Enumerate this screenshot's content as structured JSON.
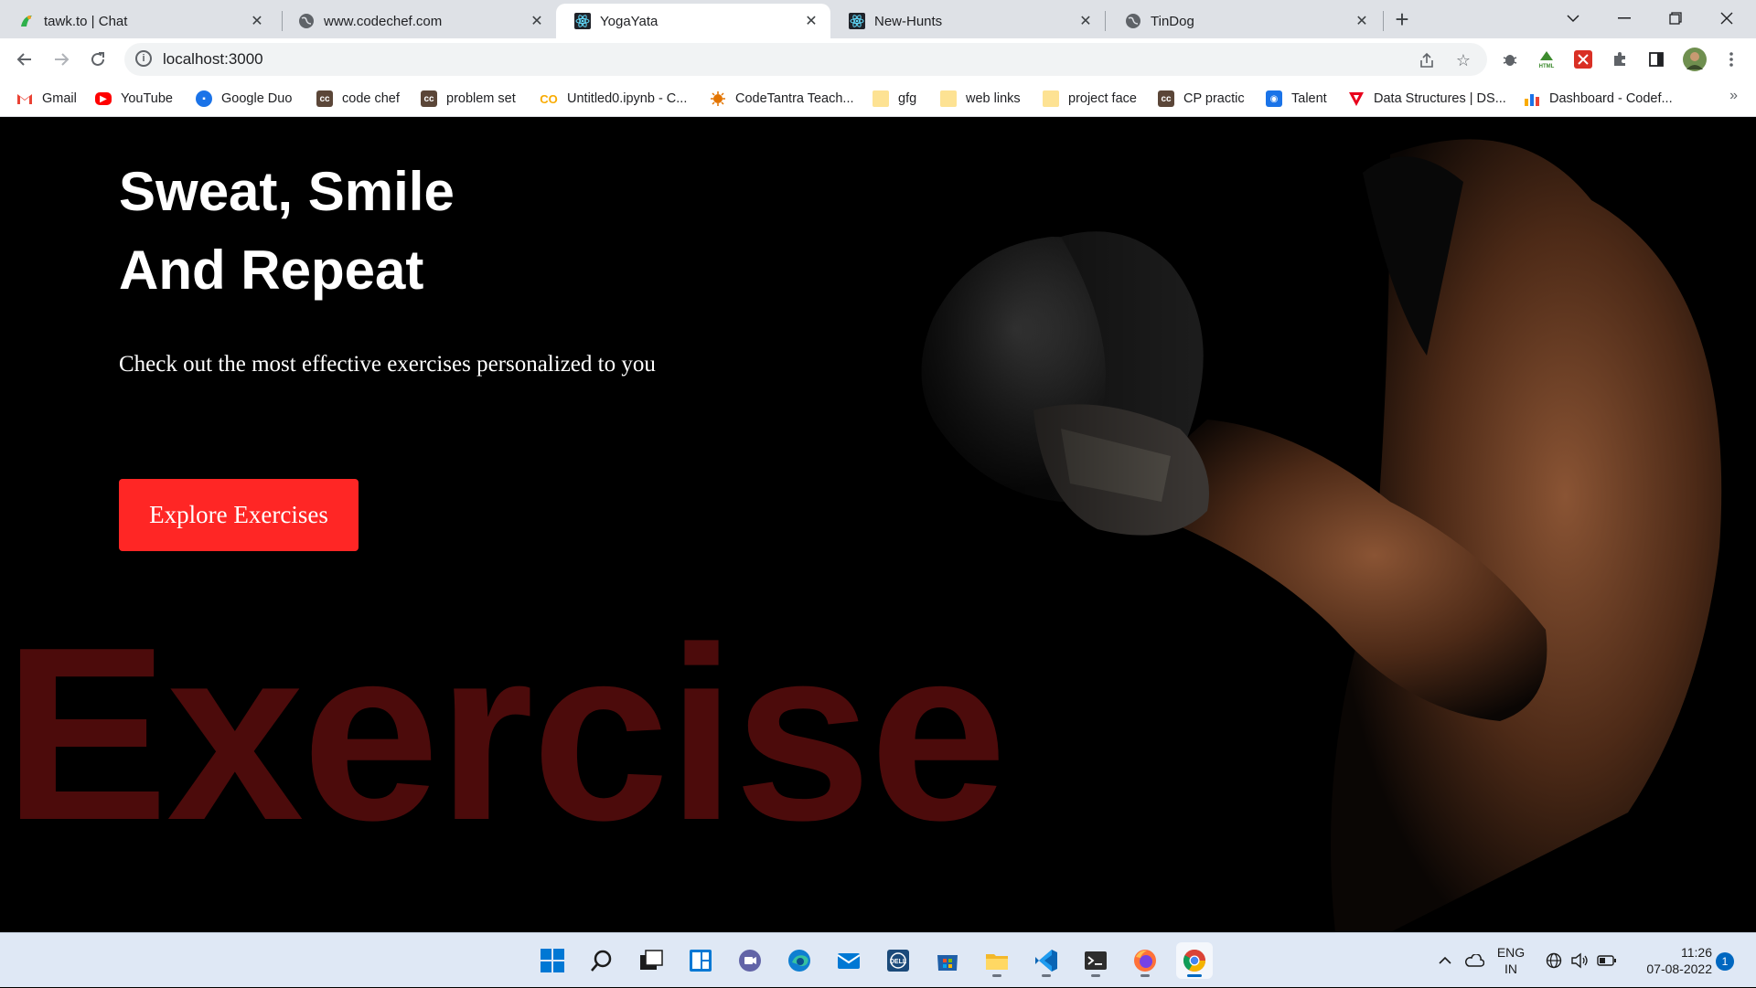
{
  "browser": {
    "tabs": [
      {
        "title": "tawk.to | Chat",
        "icon": "tawk-icon",
        "active": false
      },
      {
        "title": "www.codechef.com",
        "icon": "globe-icon",
        "active": false
      },
      {
        "title": "YogaYata",
        "icon": "react-icon",
        "active": true
      },
      {
        "title": "New-Hunts",
        "icon": "react-icon",
        "active": false
      },
      {
        "title": "TinDog",
        "icon": "globe-icon",
        "active": false
      }
    ],
    "url": "localhost:3000",
    "bookmarks": [
      {
        "label": "Gmail",
        "icon": "gmail-icon"
      },
      {
        "label": "YouTube",
        "icon": "youtube-icon"
      },
      {
        "label": "Google Duo",
        "icon": "duo-icon"
      },
      {
        "label": "code chef",
        "icon": "codechef-icon"
      },
      {
        "label": "problem set",
        "icon": "codechef-icon"
      },
      {
        "label": "Untitled0.ipynb - C...",
        "icon": "colab-icon"
      },
      {
        "label": "CodeTantra Teach...",
        "icon": "codetantra-icon"
      },
      {
        "label": "gfg",
        "icon": "folder-icon"
      },
      {
        "label": "web links",
        "icon": "folder-icon"
      },
      {
        "label": "project face",
        "icon": "folder-icon"
      },
      {
        "label": "CP practic",
        "icon": "codechef-icon"
      },
      {
        "label": "Talent",
        "icon": "talent-icon"
      },
      {
        "label": "Data Structures | DS...",
        "icon": "ds-icon"
      },
      {
        "label": "Dashboard - Codef...",
        "icon": "dashboard-icon"
      }
    ],
    "overflow": "»"
  },
  "hero": {
    "title_line1": "Sweat, Smile",
    "title_line2": "And Repeat",
    "subtitle": "Check out the most effective exercises personalized to you",
    "cta_label": "Explore Exercises",
    "background_word": "Exercise",
    "cta_color": "#ff2625",
    "background_word_color": "#5a0d0d"
  },
  "taskbar": {
    "lang_line1": "ENG",
    "lang_line2": "IN",
    "time": "11:26",
    "date": "07-08-2022",
    "notification_count": "1"
  }
}
